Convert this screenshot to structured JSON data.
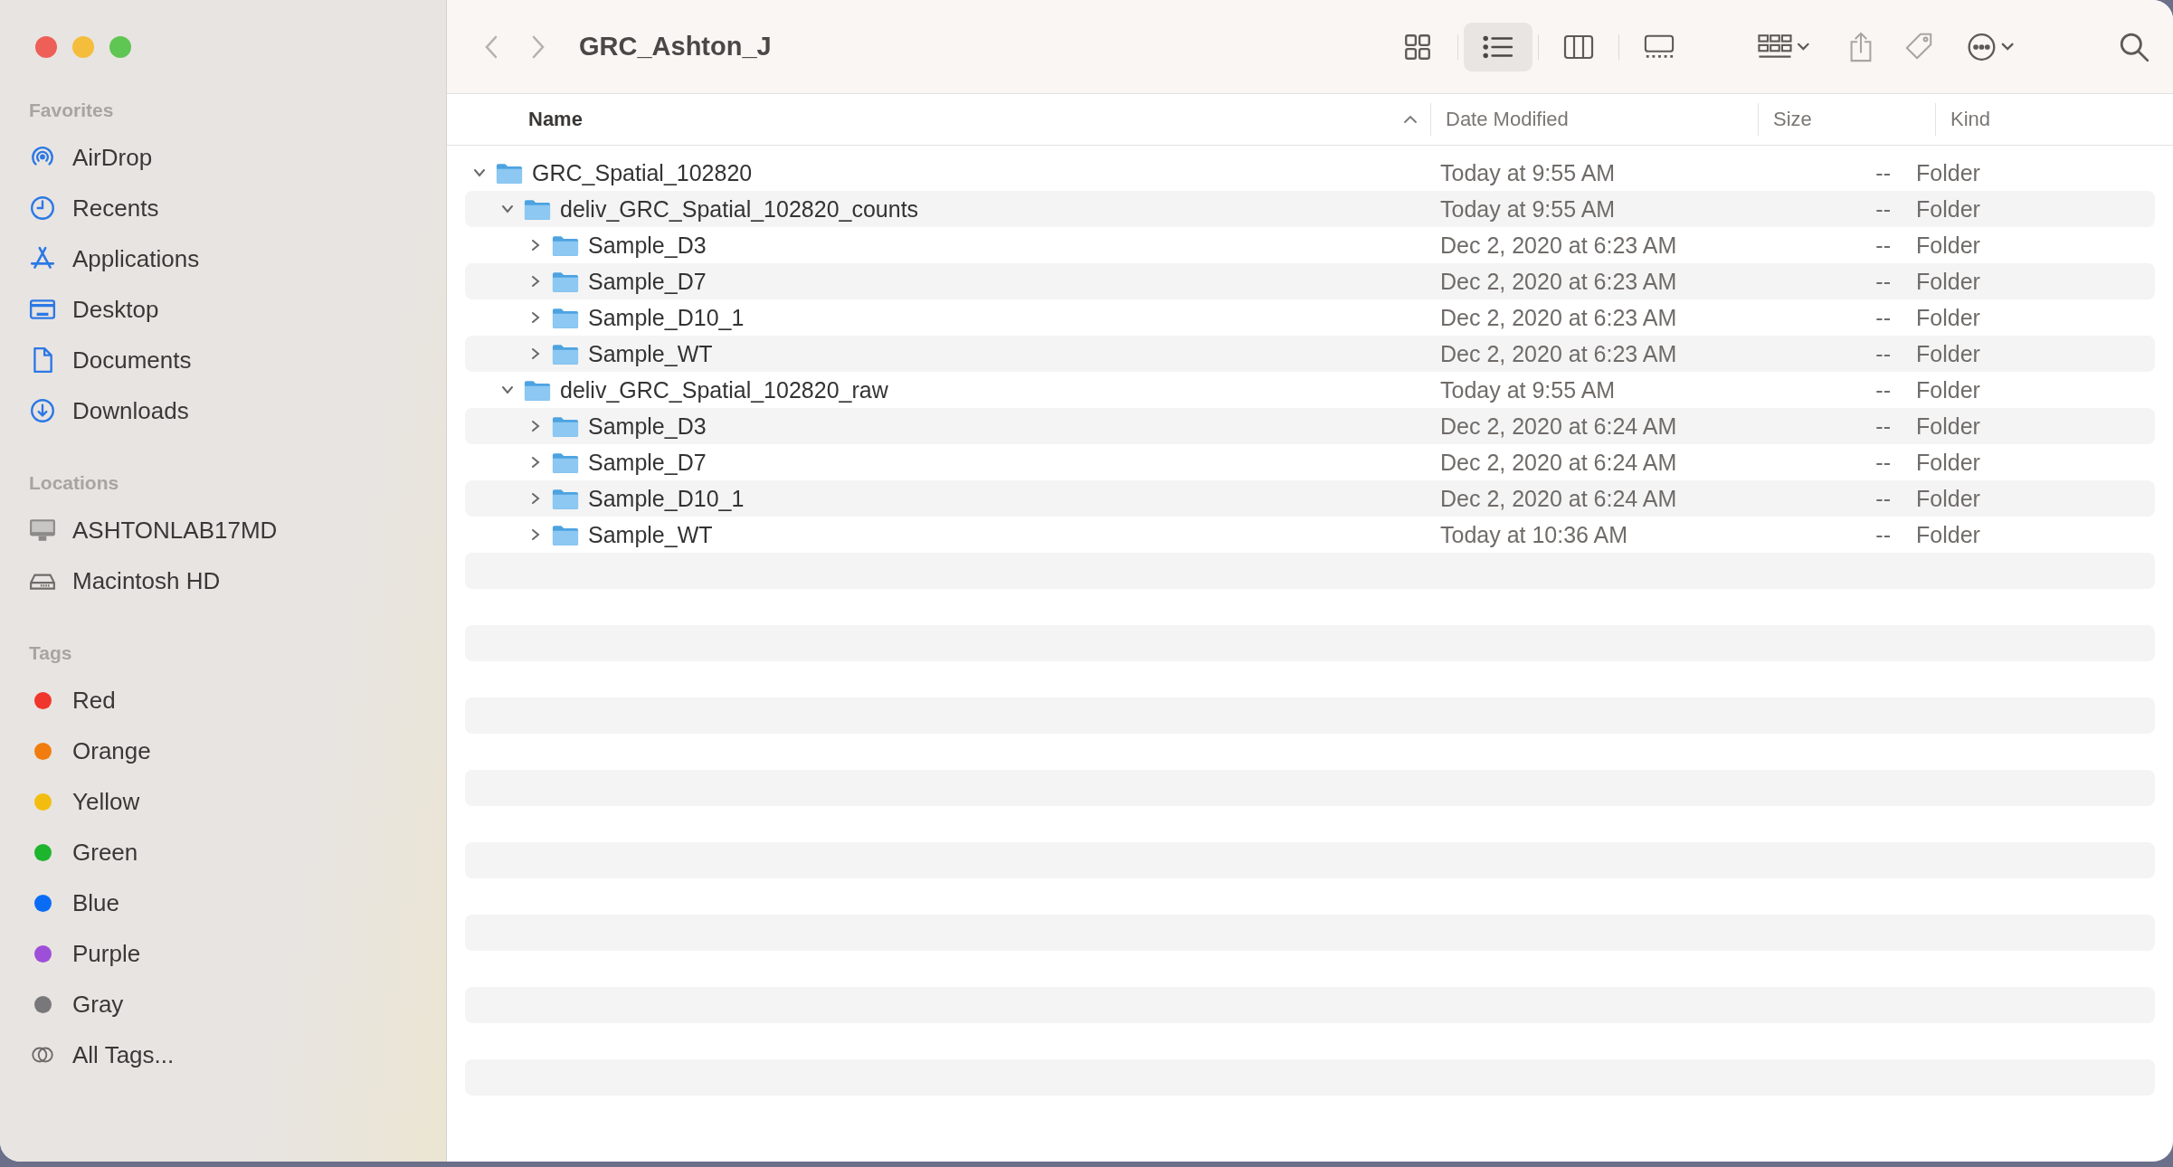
{
  "window": {
    "title": "GRC_Ashton_J"
  },
  "toolbar": {
    "view_buttons": [
      {
        "kind": "icons",
        "selected": false
      },
      {
        "kind": "list",
        "selected": true
      },
      {
        "kind": "columns",
        "selected": false
      },
      {
        "kind": "gallery",
        "selected": false
      }
    ]
  },
  "sidebar": {
    "sections": [
      {
        "title": "Favorites",
        "items": [
          {
            "label": "AirDrop",
            "kind": "airdrop"
          },
          {
            "label": "Recents",
            "kind": "clock"
          },
          {
            "label": "Applications",
            "kind": "apps"
          },
          {
            "label": "Desktop",
            "kind": "desktop"
          },
          {
            "label": "Documents",
            "kind": "document"
          },
          {
            "label": "Downloads",
            "kind": "download"
          }
        ]
      },
      {
        "title": "Locations",
        "items": [
          {
            "label": "ASHTONLAB17MD",
            "kind": "computer"
          },
          {
            "label": "Macintosh HD",
            "kind": "disk"
          }
        ]
      },
      {
        "title": "Tags",
        "items": [
          {
            "label": "Red",
            "kind": "tag",
            "color": "#f0352c"
          },
          {
            "label": "Orange",
            "kind": "tag",
            "color": "#f07d0e"
          },
          {
            "label": "Yellow",
            "kind": "tag",
            "color": "#f2bd0f"
          },
          {
            "label": "Green",
            "kind": "tag",
            "color": "#1cb52d"
          },
          {
            "label": "Blue",
            "kind": "tag",
            "color": "#0a6cf5"
          },
          {
            "label": "Purple",
            "kind": "tag",
            "color": "#9e4fd8"
          },
          {
            "label": "Gray",
            "kind": "tag",
            "color": "#78777a"
          },
          {
            "label": "All Tags...",
            "kind": "all-tags"
          }
        ]
      }
    ]
  },
  "table": {
    "columns": [
      {
        "label": "Name",
        "sorted": true
      },
      {
        "label": "Date Modified",
        "sorted": false
      },
      {
        "label": "Size",
        "sorted": false
      },
      {
        "label": "Kind",
        "sorted": false
      }
    ],
    "rows": [
      {
        "name": "GRC_Spatial_102820",
        "date_modified": "Today at 9:55 AM",
        "size": "--",
        "kind": "Folder",
        "expanded": true,
        "children": [
          {
            "name": "deliv_GRC_Spatial_102820_counts",
            "date_modified": "Today at 9:55 AM",
            "size": "--",
            "kind": "Folder",
            "expanded": true,
            "children": [
              {
                "name": "Sample_D3",
                "date_modified": "Dec 2, 2020 at 6:23 AM",
                "size": "--",
                "kind": "Folder",
                "expanded": false
              },
              {
                "name": "Sample_D7",
                "date_modified": "Dec 2, 2020 at 6:23 AM",
                "size": "--",
                "kind": "Folder",
                "expanded": false
              },
              {
                "name": "Sample_D10_1",
                "date_modified": "Dec 2, 2020 at 6:23 AM",
                "size": "--",
                "kind": "Folder",
                "expanded": false
              },
              {
                "name": "Sample_WT",
                "date_modified": "Dec 2, 2020 at 6:23 AM",
                "size": "--",
                "kind": "Folder",
                "expanded": false
              }
            ]
          },
          {
            "name": "deliv_GRC_Spatial_102820_raw",
            "date_modified": "Today at 9:55 AM",
            "size": "--",
            "kind": "Folder",
            "expanded": true,
            "children": [
              {
                "name": "Sample_D3",
                "date_modified": "Dec 2, 2020 at 6:24 AM",
                "size": "--",
                "kind": "Folder",
                "expanded": false
              },
              {
                "name": "Sample_D7",
                "date_modified": "Dec 2, 2020 at 6:24 AM",
                "size": "--",
                "kind": "Folder",
                "expanded": false
              },
              {
                "name": "Sample_D10_1",
                "date_modified": "Dec 2, 2020 at 6:24 AM",
                "size": "--",
                "kind": "Folder",
                "expanded": false
              },
              {
                "name": "Sample_WT",
                "date_modified": "Today at 10:36 AM",
                "size": "--",
                "kind": "Folder",
                "expanded": false
              }
            ]
          }
        ]
      }
    ]
  }
}
